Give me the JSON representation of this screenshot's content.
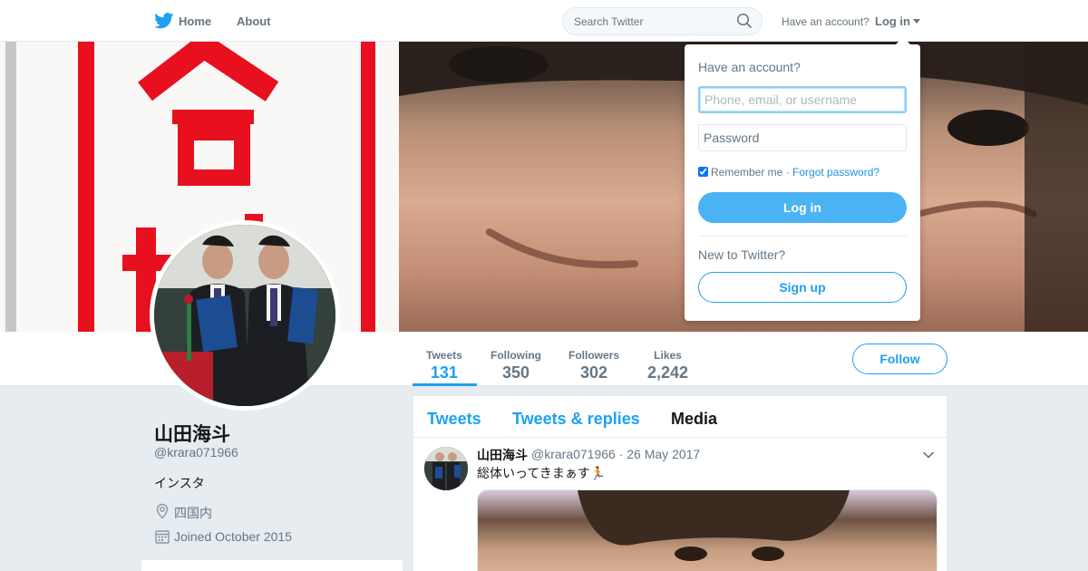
{
  "nav": {
    "home_label": "Home",
    "about_label": "About",
    "search_placeholder": "Search Twitter",
    "have_account": "Have an account?",
    "login_label": "Log in"
  },
  "profile": {
    "display_name": "山田海斗",
    "screen_name": "@krara071966",
    "bio": "インスタ",
    "location": "四国内",
    "joined": "Joined October 2015"
  },
  "stats": [
    {
      "label": "Tweets",
      "value": "131"
    },
    {
      "label": "Following",
      "value": "350"
    },
    {
      "label": "Followers",
      "value": "302"
    },
    {
      "label": "Likes",
      "value": "2,242"
    }
  ],
  "follow_label": "Follow",
  "timeline": {
    "tabs": [
      "Tweets",
      "Tweets & replies",
      "Media"
    ],
    "tweet": {
      "name": "山田海斗",
      "handle": "@krara071966 · 26 May 2017",
      "text": "総体いってきまぁす🏃"
    }
  },
  "login_dropdown": {
    "title": "Have an account?",
    "username_placeholder": "Phone, email, or username",
    "password_placeholder": "Password",
    "remember_label": "Remember me",
    "separator": " · ",
    "forgot_label": "Forgot password?",
    "login_button": "Log in",
    "new_to_twitter": "New to Twitter?",
    "signup_button": "Sign up"
  },
  "colors": {
    "accent": "#1da1f2",
    "text": "#14171a",
    "muted": "#657786",
    "background": "#e6ecf0"
  }
}
